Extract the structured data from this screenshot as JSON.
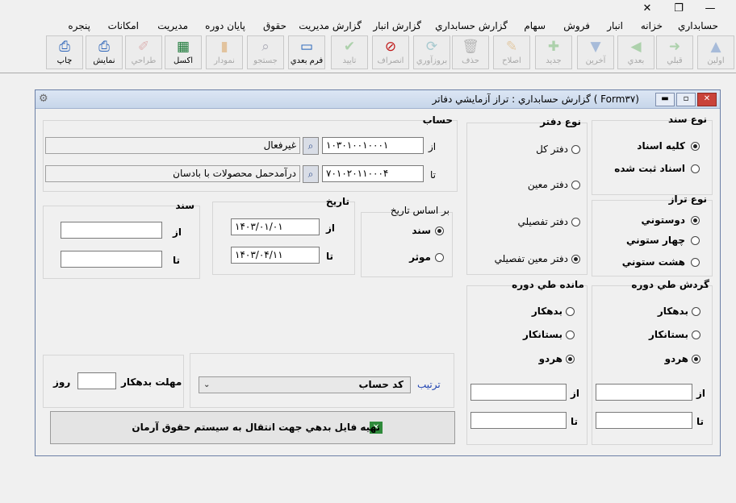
{
  "window_controls": {
    "close": "✕",
    "restore": "❐",
    "minimize": "—"
  },
  "menu": [
    "حسابداري",
    "خزانه",
    "انبار",
    "فروش",
    "سهام",
    "گزارش حسابداري",
    "گزارش انبار",
    "گزارش مديريت",
    "حقوق",
    "پايان دوره",
    "مديريت",
    "امكانات",
    "پنجره"
  ],
  "toolbar": {
    "first": "اولين",
    "prev": "قبلي",
    "next": "بعدي",
    "last": "آخرين",
    "new": "جديد",
    "edit": "اصلاح",
    "delete": "حذف",
    "refresh": "بروزآوري",
    "cancel": "انصراف",
    "confirm": "تاييد",
    "next_form": "فرم بعدي",
    "search": "جستجو",
    "chart": "نمودار",
    "excel": "اكسل",
    "design": "طراحي",
    "preview": "نمايش",
    "print": "چاپ"
  },
  "form": {
    "title": "گزارش حسابداري : تراز آزمايشي دفاتر ( Form۳۷)",
    "hesab": {
      "title": "حساب",
      "from_label": "از",
      "from_code": "۱۰۳۰۱۰۰۱۰۰۰۱",
      "from_name": "غیرفعال",
      "to_label": "تا",
      "to_code": "۷۰۱۰۲۰۱۱۰۰۰۴",
      "to_name": "درآمدحمل محصولات با بادسان"
    },
    "noe_sanad": {
      "title": "نوع سند",
      "opt1": "كليه اسناد",
      "opt2": "اسناد ثبت شده"
    },
    "noe_daftar": {
      "title": "نوع دفتر",
      "opt1": "دفتر كل",
      "opt2": "دفتر معين",
      "opt3": "دفتر تفصيلي",
      "opt4": "دفتر معين تفصيلي"
    },
    "noe_taraz": {
      "title": "نوع تراز",
      "opt1": "دوستوني",
      "opt2": "چهار ستوني",
      "opt3": "هشت ستوني"
    },
    "sanad": {
      "title": "سند",
      "from_label": "از",
      "to_label": "تا",
      "from_value": "",
      "to_value": ""
    },
    "tarikh": {
      "title": "تاريخ",
      "from_label": "از",
      "to_label": "تا",
      "from_value": "۱۴۰۳/۰۱/۰۱",
      "to_value": "۱۴۰۳/۰۴/۱۱"
    },
    "bar_asas": {
      "title": "بر اساس تاريخ",
      "opt1": "سند",
      "opt2": "موثر"
    },
    "mande": {
      "title": "مانده طي دوره",
      "opt1": "بدهكار",
      "opt2": "بستانكار",
      "opt3": "هردو",
      "from_label": "از",
      "to_label": "تا"
    },
    "gardesh": {
      "title": "گردش طي دوره",
      "opt1": "بدهكار",
      "opt2": "بستانكار",
      "opt3": "هردو",
      "from_label": "از",
      "to_label": "تا"
    },
    "mohlat": {
      "label": "مهلت بدهكار",
      "unit": "روز",
      "value": ""
    },
    "tartib": {
      "label": "ترتيب",
      "value": "كد حساب"
    },
    "export_button": "تهيه فايل بدهي جهت انتقال به سيستم حقوق آرمان"
  }
}
